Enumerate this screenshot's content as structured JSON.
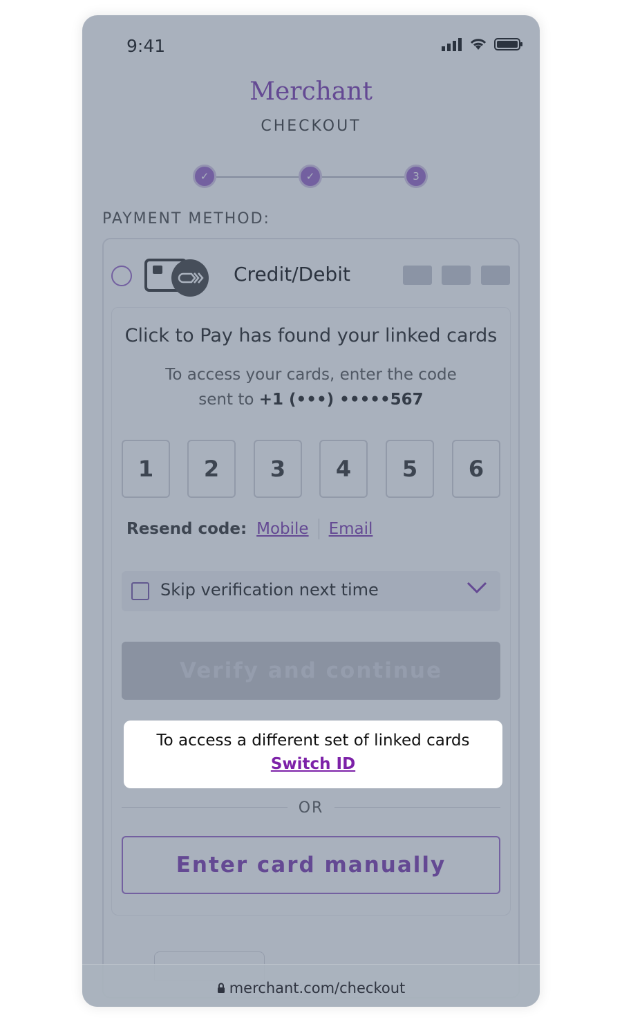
{
  "status": {
    "time": "9:41"
  },
  "header": {
    "brand": "Merchant",
    "subtitle": "CHECKOUT"
  },
  "stepper": {
    "steps": [
      "✓",
      "✓",
      "3"
    ]
  },
  "payment": {
    "section_label": "PAYMENT METHOD:",
    "option_label": "Credit/Debit"
  },
  "verification": {
    "headline": "Click to Pay has found your linked cards",
    "sub_line1": "To access your cards, enter the code",
    "sub_prefix": "sent to",
    "phone_masked": "+1 (•••) •••••567",
    "code_digits": [
      "1",
      "2",
      "3",
      "4",
      "5",
      "6"
    ],
    "resend_label": "Resend code:",
    "resend_mobile": "Mobile",
    "resend_email": "Email",
    "skip_label": "Skip verification next time",
    "verify_button": "Verify and continue",
    "or_label": "OR",
    "manual_button": "Enter card manually"
  },
  "tooltip": {
    "text": "To access a different set of linked cards",
    "link": "Switch ID"
  },
  "browser": {
    "url": "merchant.com/checkout"
  },
  "colors": {
    "accent": "#7d3bb0",
    "overlay": "#485a72"
  }
}
